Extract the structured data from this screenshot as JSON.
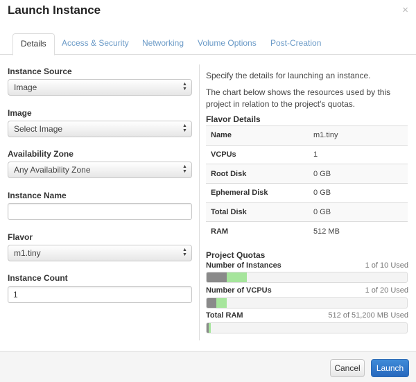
{
  "header": {
    "title": "Launch Instance",
    "close_glyph": "×"
  },
  "tabs": [
    {
      "label": "Details",
      "active": true
    },
    {
      "label": "Access & Security",
      "active": false
    },
    {
      "label": "Networking",
      "active": false
    },
    {
      "label": "Volume Options",
      "active": false
    },
    {
      "label": "Post-Creation",
      "active": false
    }
  ],
  "form": {
    "instance_source": {
      "label": "Instance Source",
      "value": "Image"
    },
    "image": {
      "label": "Image",
      "value": "Select Image"
    },
    "availability_zone": {
      "label": "Availability Zone",
      "value": "Any Availability Zone"
    },
    "instance_name": {
      "label": "Instance Name",
      "value": ""
    },
    "flavor": {
      "label": "Flavor",
      "value": "m1.tiny"
    },
    "instance_count": {
      "label": "Instance Count",
      "value": "1"
    }
  },
  "help": {
    "line1": "Specify the details for launching an instance.",
    "line2": "The chart below shows the resources used by this project in relation to the project's quotas."
  },
  "flavor_details": {
    "title": "Flavor Details",
    "rows": [
      {
        "key": "Name",
        "value": "m1.tiny"
      },
      {
        "key": "VCPUs",
        "value": "1"
      },
      {
        "key": "Root Disk",
        "value": "0 GB"
      },
      {
        "key": "Ephemeral Disk",
        "value": "0 GB"
      },
      {
        "key": "Total Disk",
        "value": "0 GB"
      },
      {
        "key": "RAM",
        "value": "512 MB"
      }
    ]
  },
  "quotas": {
    "title": "Project Quotas",
    "items": [
      {
        "label": "Number of Instances",
        "used_text": "1 of 10 Used",
        "used_fraction": 0.1,
        "added_fraction": 0.1
      },
      {
        "label": "Number of VCPUs",
        "used_text": "1 of 20 Used",
        "used_fraction": 0.05,
        "added_fraction": 0.05
      },
      {
        "label": "Total RAM",
        "used_text": "512 of 51,200 MB Used",
        "used_fraction": 0.01,
        "added_fraction": 0.01
      }
    ],
    "colors": {
      "used": "#8a8a8a",
      "added": "#a6e59c"
    }
  },
  "footer": {
    "cancel_label": "Cancel",
    "launch_label": "Launch"
  },
  "colors": {
    "tab_link": "#6a9ac7",
    "primary": "#2f78c8"
  }
}
